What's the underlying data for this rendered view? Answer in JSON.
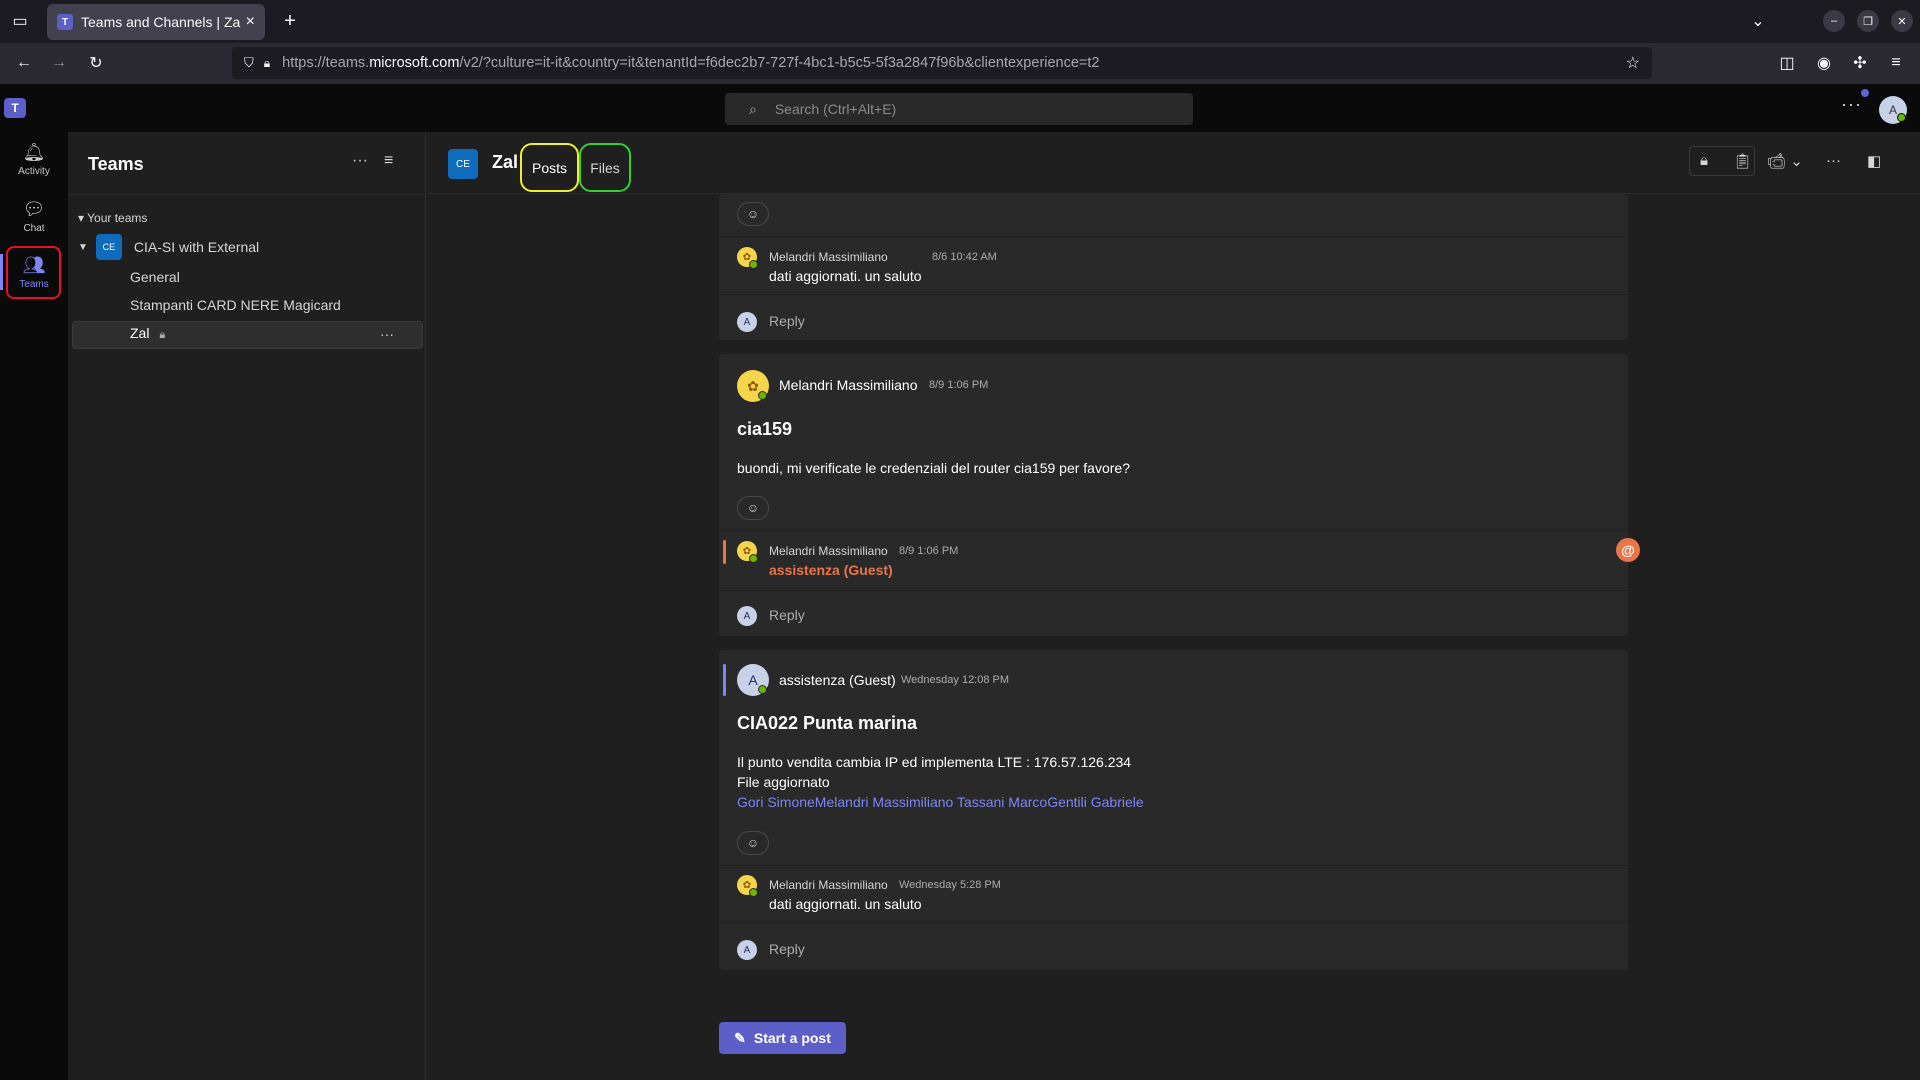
{
  "browser": {
    "tab_title": "Teams and Channels | Zal",
    "url_prefix": "https://teams.",
    "url_domain": "microsoft.com",
    "url_suffix": "/v2/?culture=it-it&country=it&tenantId=f6dec2b7-727f-4bc1-b5c5-5f3a2847f96b&clientexperience=t2"
  },
  "topbar": {
    "search_placeholder": "Search (Ctrl+Alt+E)",
    "avatar_initial": "A"
  },
  "appbar": {
    "items": [
      {
        "label": "Activity",
        "icon": "bell-icon"
      },
      {
        "label": "Chat",
        "icon": "chat-icon"
      },
      {
        "label": "Teams",
        "icon": "teams-icon"
      }
    ]
  },
  "pane": {
    "title": "Teams",
    "section_label": "Your teams",
    "team": {
      "badge": "CE",
      "name": "CIA-SI with External"
    },
    "channels": [
      "General",
      "Stampanti CARD NERE Magicard",
      "Zal"
    ]
  },
  "channel_header": {
    "badge": "CE",
    "name": "Zal",
    "tabs": [
      "Posts",
      "Files"
    ]
  },
  "thread1": {
    "reply": {
      "author": "Melandri Massimiliano",
      "time": "8/6 10:42 AM",
      "text": "dati aggiornati. un saluto"
    },
    "reply_label": "Reply"
  },
  "thread2": {
    "author": "Melandri Massimiliano",
    "time": "8/9 1:06 PM",
    "subject": "cia159",
    "body": "buondi, mi verificate le credenziali del router cia159 per favore?",
    "reply": {
      "author": "Melandri Massimiliano",
      "time": "8/9 1:06 PM",
      "mention": "assistenza (Guest)"
    },
    "reply_label": "Reply"
  },
  "thread3": {
    "author": "assistenza (Guest)",
    "time": "Wednesday 12:08 PM",
    "subject": "CIA022 Punta marina",
    "body_line1": "Il punto vendita cambia IP ed implementa LTE : 176.57.126.234",
    "body_line2": "File aggiornato",
    "mentions": "Gori SimoneMelandri Massimiliano Tassani MarcoGentili Gabriele",
    "reply": {
      "author": "Melandri Massimiliano",
      "time": "Wednesday 5:28 PM",
      "text": "dati aggiornati. un saluto"
    },
    "reply_label": "Reply"
  },
  "start_post_label": "Start a post",
  "colors": {
    "accent": "#5b5fc7",
    "mention": "#e97548",
    "posts_highlight": "#f1ef2a",
    "files_highlight": "#2ed12e",
    "teams_highlight": "#e81123"
  }
}
